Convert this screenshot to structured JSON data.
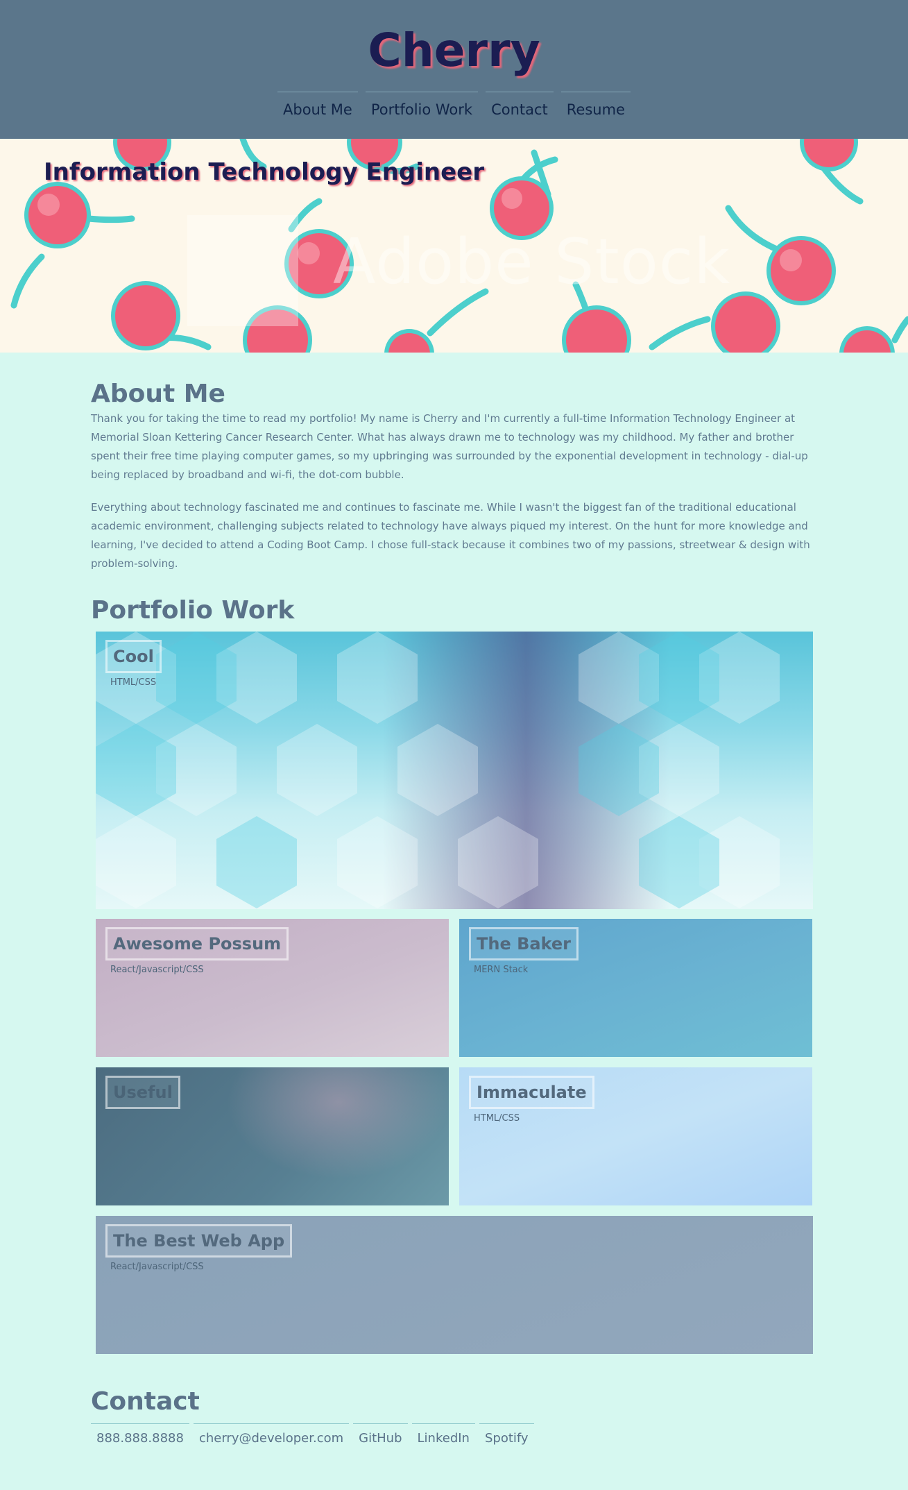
{
  "header": {
    "brand": "Cherry",
    "nav": [
      "About Me",
      "Portfolio Work",
      "Contact",
      "Resume"
    ]
  },
  "hero": {
    "title": "Information Technology Engineer",
    "watermark": "Adobe Stock"
  },
  "about": {
    "title": "About Me",
    "paragraphs": [
      "Thank you for taking the time to read my portfolio! My name is Cherry and I'm currently a full-time Information Technology Engineer at Memorial Sloan Kettering Cancer Research Center. What has always drawn me to technology was my childhood. My father and brother spent their free time playing computer games, so my upbringing was surrounded by the exponential development in technology - dial-up being replaced by broadband and wi-fi, the dot-com bubble.",
      "Everything about technology fascinated me and continues to fascinate me. While I wasn't the biggest fan of the traditional educational academic environment, challenging subjects related to technology have always piqued my interest. On the hunt for more knowledge and learning, I've decided to attend a Coding Boot Camp. I chose full-stack because it combines two of my passions, streetwear & design with problem-solving."
    ]
  },
  "portfolio": {
    "title": "Portfolio Work",
    "projects": [
      {
        "name": "Cool",
        "tech": "HTML/CSS"
      },
      {
        "name": "Awesome Possum",
        "tech": "React/Javascript/CSS"
      },
      {
        "name": "The Baker",
        "tech": "MERN Stack"
      },
      {
        "name": "Useful",
        "tech": ""
      },
      {
        "name": "Immaculate",
        "tech": "HTML/CSS"
      },
      {
        "name": "The Best Web App",
        "tech": "React/Javascript/CSS"
      }
    ]
  },
  "contact": {
    "title": "Contact",
    "links": [
      "888.888.8888",
      "cherry@developer.com",
      "GitHub",
      "LinkedIn",
      "Spotify"
    ]
  },
  "colors": {
    "header_bg": "#5b768b",
    "brand": "#1b1d52",
    "brand_shadow": "#e4677a",
    "page_bg": "#d6f8f0",
    "heading": "#5a7289"
  }
}
